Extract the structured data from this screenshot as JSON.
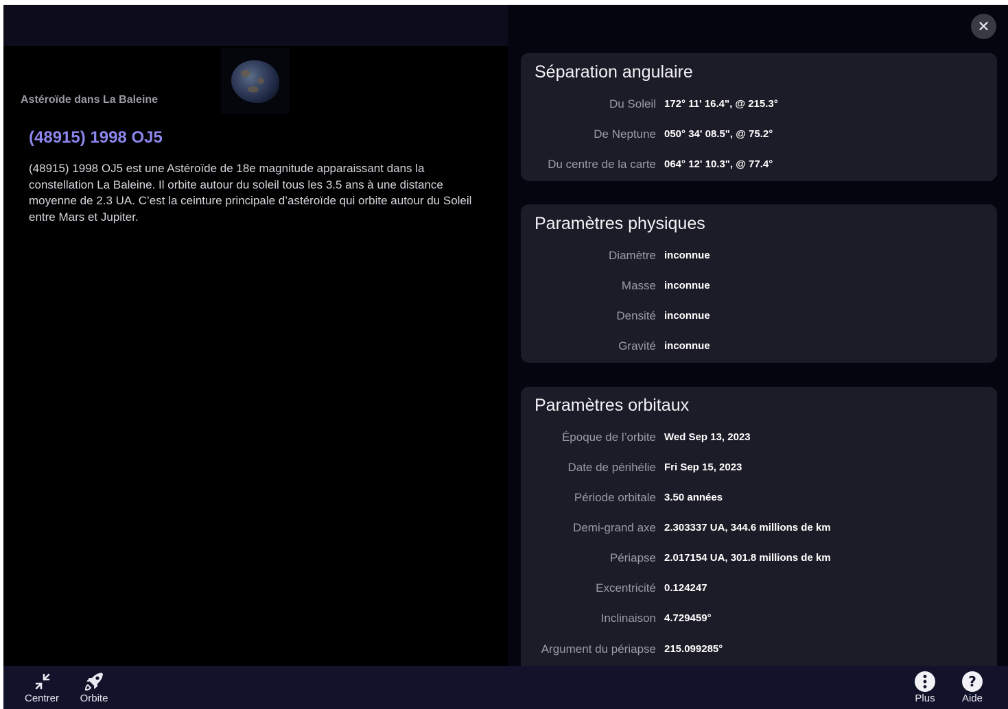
{
  "object": {
    "type_label": "Astéroïde dans La Baleine",
    "title": "(48915) 1998 OJ5",
    "description": "(48915) 1998 OJ5 est une Astéroïde de 18e magnitude apparaissant dans la constellation La Baleine. Il orbite autour du soleil tous les 3.5 ans à une distance moyenne de 2.3 UA. C’est la ceinture principale d’astéroïde qui orbite autour du Soleil entre Mars et Jupiter."
  },
  "close_icon": "close-icon",
  "sections": {
    "angular": {
      "title": "Séparation angulaire",
      "rows": [
        {
          "label": "Du Soleil",
          "value": "172° 11' 16.4\", @ 215.3°"
        },
        {
          "label": "De Neptune",
          "value": "050° 34' 08.5\", @ 75.2°"
        },
        {
          "label": "Du centre de la carte",
          "value": "064° 12' 10.3\", @ 77.4°"
        }
      ]
    },
    "physical": {
      "title": "Paramètres physiques",
      "rows": [
        {
          "label": "Diamètre",
          "value": "inconnue"
        },
        {
          "label": "Masse",
          "value": "inconnue"
        },
        {
          "label": "Densité",
          "value": "inconnue"
        },
        {
          "label": "Gravité",
          "value": "inconnue"
        }
      ]
    },
    "orbital": {
      "title": "Paramètres orbitaux",
      "rows": [
        {
          "label": "Époque de l’orbite",
          "value": "Wed Sep 13, 2023"
        },
        {
          "label": "Date de périhélie",
          "value": "Fri Sep 15, 2023"
        },
        {
          "label": "Période orbitale",
          "value": "3.50 années"
        },
        {
          "label": "Demi-grand axe",
          "value": "2.303337 UA, 344.6 millions de km"
        },
        {
          "label": "Périapse",
          "value": "2.017154 UA, 301.8 millions de km"
        },
        {
          "label": "Excentricité",
          "value": "0.124247"
        },
        {
          "label": "Inclinaison",
          "value": "4.729459°"
        },
        {
          "label": "Argument du périapse",
          "value": "215.099285°"
        }
      ]
    }
  },
  "toolbar": {
    "center": {
      "label": "Centrer",
      "icon": "collapse-arrows-icon"
    },
    "orbit": {
      "label": "Orbite",
      "icon": "rocket-icon"
    },
    "more": {
      "label": "Plus",
      "icon": "more-icon"
    },
    "help": {
      "label": "Aide",
      "icon": "help-icon"
    }
  },
  "colors": {
    "title": "#8b86ec",
    "card": "#1c1c28",
    "toolbar": "#12122a"
  }
}
